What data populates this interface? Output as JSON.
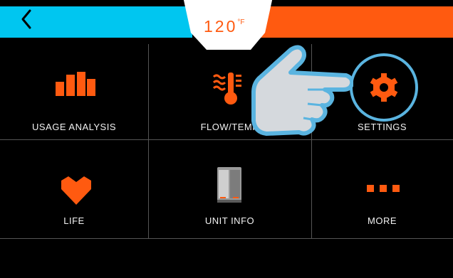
{
  "header": {
    "back_icon": "chevron-left-icon",
    "temperature_value": "120",
    "temperature_unit": "°F",
    "colors": {
      "left_band": "#00c6f0",
      "right_band": "#ff5a10",
      "center_tab": "#ffffff"
    }
  },
  "menu": {
    "tiles": [
      {
        "label": "USAGE ANALYSIS",
        "icon": "bar-chart-icon"
      },
      {
        "label": "FLOW/TEMP",
        "icon": "flow-temp-icon"
      },
      {
        "label": "SETTINGS",
        "icon": "gear-icon"
      },
      {
        "label": "LIFE",
        "icon": "heart-icon"
      },
      {
        "label": "UNIT INFO",
        "icon": "water-heater-unit-icon"
      },
      {
        "label": "MORE",
        "icon": "more-dots-icon"
      }
    ],
    "accent_color": "#ff5a10",
    "highlight_color": "#5ab4e0"
  },
  "overlay": {
    "icon": "pointing-hand-icon"
  }
}
